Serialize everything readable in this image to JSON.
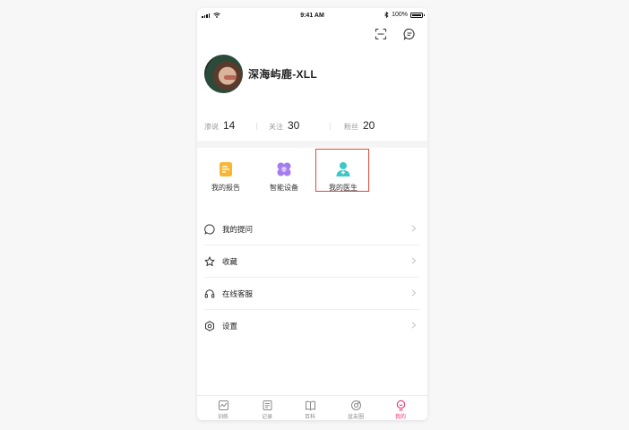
{
  "status_bar": {
    "time": "9:41 AM",
    "battery": "100%"
  },
  "header": {
    "scan_icon": "scan-icon",
    "message_icon": "message-icon"
  },
  "profile": {
    "name": "深海屿鹿-XLL"
  },
  "stats": [
    {
      "label": "渗说",
      "value": "14"
    },
    {
      "label": "关注",
      "value": "30"
    },
    {
      "label": "粉丝",
      "value": "20"
    }
  ],
  "shortcuts": [
    {
      "label": "我的报告",
      "icon": "report-icon",
      "color": "#f7b733"
    },
    {
      "label": "智能设备",
      "icon": "device-icon",
      "color": "#a57cf0"
    },
    {
      "label": "我的医生",
      "icon": "doctor-icon",
      "color": "#3cc8c8"
    }
  ],
  "menu": [
    {
      "label": "我的提问",
      "icon": "question-icon"
    },
    {
      "label": "收藏",
      "icon": "star-icon"
    },
    {
      "label": "在线客服",
      "icon": "headset-icon"
    },
    {
      "label": "设置",
      "icon": "settings-icon"
    }
  ],
  "tabbar": [
    {
      "label": "训练",
      "icon": "training-icon"
    },
    {
      "label": "记录",
      "icon": "record-icon"
    },
    {
      "label": "百科",
      "icon": "book-icon"
    },
    {
      "label": "盆友圈",
      "icon": "circle-icon"
    },
    {
      "label": "我的",
      "icon": "profile-icon",
      "active": true
    }
  ],
  "colors": {
    "accent": "#e8336e",
    "highlight": "#e4473c"
  }
}
